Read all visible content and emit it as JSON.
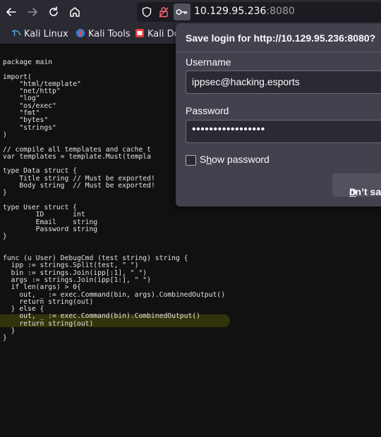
{
  "browser": {
    "url_host": "10.129.95.236",
    "url_port": ":8080"
  },
  "bookmarks": [
    {
      "label": "Kali Linux"
    },
    {
      "label": "Kali Tools"
    },
    {
      "label": "Kali Do"
    }
  ],
  "code_lines": [
    "package main",
    "",
    "import(",
    "    \"html/template\"",
    "    \"net/http\"",
    "    \"log\"",
    "    \"os/exec\"",
    "    \"fmt\"",
    "    \"bytes\"",
    "    \"strings\"",
    ")",
    "",
    "// compile all templates and cache t",
    "var templates = template.Must(templa",
    "",
    "type Data struct {",
    "    Title string // Must be exported!",
    "    Body string  // Must be exported!",
    "}",
    "",
    "type User struct {",
    "        ID       int",
    "        Email    string",
    "        Password string",
    "}",
    "",
    "",
    "func (u User) DebugCmd (test string) string {",
    "  ipp := strings.Split(test, \" \")",
    "  bin := strings.Join(ipp[:1], \" \")",
    "  args := strings.Join(ipp[1:], \" \")",
    "  if len(args) > 0{",
    "    out, _ := exec.Command(bin, args).CombinedOutput()",
    "    return string(out)",
    "  } else {",
    "    out, _ := exec.Command(bin).CombinedOutput()",
    "    return string(out)",
    "  }",
    "}"
  ],
  "save_login": {
    "title": "Save login for http://10.129.95.236:8080?",
    "username_label": "Username",
    "username_value": "ippsec@hacking.esports",
    "password_label": "Password",
    "password_dots": "•••••••••••••••••",
    "show_password_s": "S",
    "show_password_h": "h",
    "show_password_rest": "ow password",
    "dont_d": "D",
    "dont_rest": "on’t save"
  },
  "colors": {
    "toolbar": "#2b2a33",
    "popup": "#42414d",
    "highlight": "#3c3c0c"
  }
}
